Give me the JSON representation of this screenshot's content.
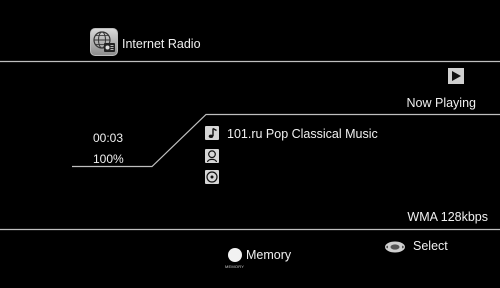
{
  "header": {
    "source_title": "Internet Radio",
    "source_icon": "internet-radio-icon"
  },
  "playback": {
    "status_icon": "play-icon",
    "status_label": "Now Playing",
    "elapsed_time": "00:03",
    "volume": "100%"
  },
  "track": {
    "song_icon": "music-note-icon",
    "song_title": "101.ru Pop Classical Music",
    "artist_icon": "artist-icon",
    "artist": "",
    "album_icon": "album-disc-icon",
    "album": "",
    "format": "WMA 128kbps"
  },
  "footer": {
    "memory_label": "Memory",
    "memory_button_caption": "MEMORY",
    "memory_button_color": "#f2f2f2",
    "select_icon": "cursor-select-icon",
    "select_label": "Select"
  },
  "colors": {
    "background": "#000000",
    "text": "#f0f0f0",
    "divider": "#bfbfbf"
  }
}
